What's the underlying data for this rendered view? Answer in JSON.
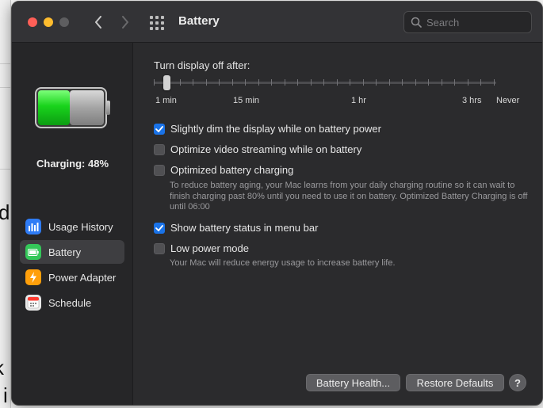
{
  "window": {
    "title": "Battery",
    "search_placeholder": "Search"
  },
  "sidebar": {
    "charging_status": "Charging: 48%",
    "battery_level_percent": 48,
    "items": [
      {
        "label": "Usage History",
        "icon": "bar-chart-icon",
        "color": "#2f7cf6"
      },
      {
        "label": "Battery",
        "icon": "battery-icon",
        "color": "#34c759",
        "active": true
      },
      {
        "label": "Power Adapter",
        "icon": "lightning-icon",
        "color": "#ff9f0a"
      },
      {
        "label": "Schedule",
        "icon": "calendar-icon",
        "color": "#e9e9e9"
      }
    ]
  },
  "main": {
    "display_off_label": "Turn display off after:",
    "slider_labels": [
      "1 min",
      "15 min",
      "1 hr",
      "3 hrs",
      "Never"
    ],
    "slider_value": "1 min",
    "options": [
      {
        "label": "Slightly dim the display while on battery power",
        "checked": true
      },
      {
        "label": "Optimize video streaming while on battery",
        "checked": false
      },
      {
        "label": "Optimized battery charging",
        "checked": false
      },
      {
        "label": "Show battery status in menu bar",
        "checked": true
      },
      {
        "label": "Low power mode",
        "checked": false
      }
    ],
    "optimized_charging_note": "To reduce battery aging, your Mac learns from your daily charging routine so it can wait to finish charging past 80% until you need to use it on battery. Optimized Battery Charging is off until 06:00",
    "low_power_note": "Your Mac will reduce energy usage to increase battery life."
  },
  "buttons": {
    "battery_health": "Battery Health...",
    "restore_defaults": "Restore Defaults",
    "help": "?"
  },
  "colors": {
    "accent": "#1a73e8",
    "battery_green": "#34c759"
  }
}
